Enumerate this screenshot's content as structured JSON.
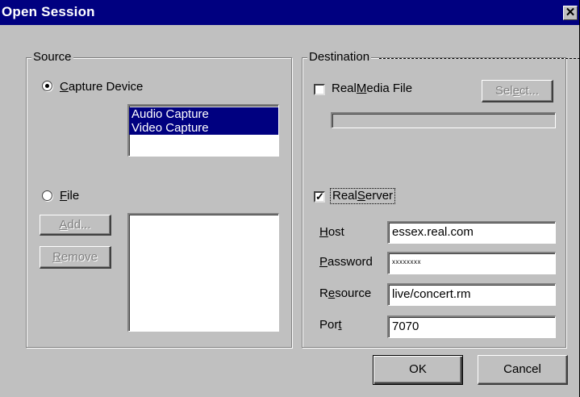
{
  "window": {
    "title": "Open Session",
    "close_glyph": "✕"
  },
  "source": {
    "legend": "Source",
    "capture_device": {
      "mnemonic": "C",
      "label_rest": "apture Device",
      "selected": true
    },
    "capture_list": [
      "Audio Capture",
      "Video Capture"
    ],
    "file": {
      "mnemonic": "F",
      "label_rest": "ile",
      "selected": false
    },
    "add_button": {
      "mnemonic": "A",
      "label_rest": "dd..."
    },
    "remove_button": {
      "mnemonic": "R",
      "label_rest": "emove"
    }
  },
  "destination": {
    "legend": "Destination",
    "realmedia": {
      "label_pre": "Real",
      "mnemonic": "M",
      "label_rest": "edia File",
      "checked": false
    },
    "select_button": {
      "label_pre": "Sel",
      "mnemonic": "e",
      "label_rest": "ct..."
    },
    "realserver": {
      "label_pre": "Real",
      "mnemonic": "S",
      "label_rest": "erver",
      "checked": true,
      "check_glyph": "✓"
    },
    "host": {
      "mnemonic": "H",
      "label_rest": "ost",
      "value": "essex.real.com"
    },
    "password": {
      "mnemonic": "P",
      "label_rest": "assword",
      "value": "xxxxxxxx"
    },
    "resource": {
      "label_pre": "R",
      "mnemonic": "e",
      "label_rest": "source",
      "value": "live/concert.rm"
    },
    "port": {
      "label_pre": "Por",
      "mnemonic": "t",
      "label_rest": "",
      "value": "7070"
    }
  },
  "buttons": {
    "ok": "OK",
    "cancel": "Cancel"
  }
}
